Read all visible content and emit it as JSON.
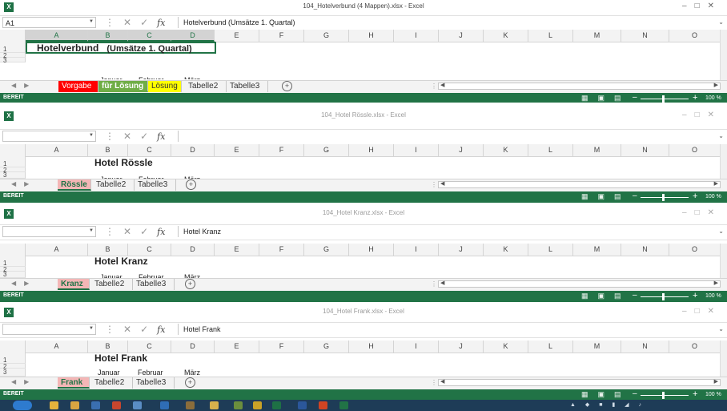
{
  "columns": [
    "A",
    "B",
    "C",
    "D",
    "E",
    "F",
    "G",
    "H",
    "I",
    "J",
    "K",
    "L",
    "M",
    "N",
    "O"
  ],
  "status_label": "BEREIT",
  "zoom_level": "100 %",
  "windows": [
    {
      "title": "104_Hotelverbund (4 Mappen).xlsx - Excel",
      "namebox": "A1",
      "formula": "Hotelverbund    (Umsätze 1. Quartal)",
      "cell_title": "Hotelverbund",
      "cell_title_sub": "(Umsätze 1. Quartal)",
      "row3": [
        "Januar",
        "Februar",
        "März"
      ],
      "rows": [
        "1",
        "2",
        "3"
      ],
      "tabs": [
        "Vorgabe",
        "für Lösung",
        "Lösung",
        "Tabelle2",
        "Tabelle3"
      ]
    },
    {
      "title": "104_Hotel Rössle.xlsx - Excel",
      "namebox": "",
      "formula": "",
      "cell_title": "Hotel Rössle",
      "row3": [
        "Januar",
        "Februar",
        "März"
      ],
      "rows": [
        "1",
        "2",
        "3"
      ],
      "tabs": [
        "Rössle",
        "Tabelle2",
        "Tabelle3"
      ]
    },
    {
      "title": "104_Hotel Kranz.xlsx - Excel",
      "namebox": "",
      "formula": "Hotel Kranz",
      "cell_title": "Hotel Kranz",
      "row3": [
        "Januar",
        "Februar",
        "März"
      ],
      "rows": [
        "1",
        "2",
        "3"
      ],
      "tabs": [
        "Kranz",
        "Tabelle2",
        "Tabelle3"
      ]
    },
    {
      "title": "104_Hotel Frank.xlsx - Excel",
      "namebox": "",
      "formula": "Hotel Frank",
      "cell_title": "Hotel Frank",
      "row3": [
        "Januar",
        "Februar",
        "März"
      ],
      "rows": [
        "1",
        "2",
        "3"
      ],
      "tabs": [
        "Frank",
        "Tabelle2",
        "Tabelle3"
      ]
    }
  ],
  "colors": {
    "excel_green": "#217346",
    "tab_vorgabe": "#ff0000",
    "tab_fuer_loesung": "#70ad47",
    "tab_loesung": "#ffff00",
    "tab_highlight": "#f4b6b6"
  },
  "icons": [
    "excel-icon",
    "fx-icon",
    "cancel-icon",
    "enter-icon",
    "new-sheet-icon",
    "normal-view-icon",
    "page-layout-icon",
    "page-break-icon",
    "minimize-icon",
    "maximize-icon",
    "close-icon",
    "start-icon"
  ]
}
